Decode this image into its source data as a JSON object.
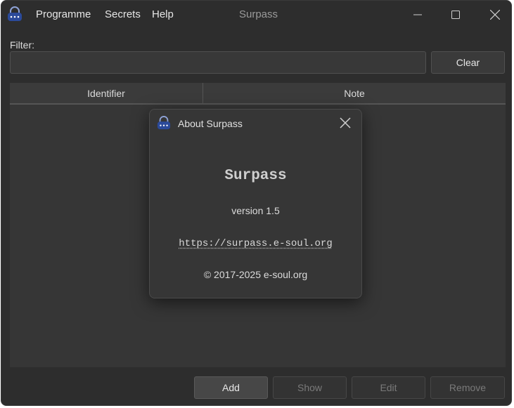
{
  "window": {
    "title": "Surpass"
  },
  "menu": [
    {
      "label": "Programme"
    },
    {
      "label": "Secrets"
    },
    {
      "label": "Help"
    }
  ],
  "filter": {
    "label": "Filter:",
    "value": "",
    "placeholder": ""
  },
  "buttons": {
    "clear": "Clear",
    "add": "Add",
    "show": "Show",
    "edit": "Edit",
    "remove": "Remove"
  },
  "table": {
    "columns": [
      "Identifier",
      "Note"
    ],
    "rows": []
  },
  "about_dialog": {
    "title": "About Surpass",
    "app_name": "Surpass",
    "version": "version 1.5",
    "url": "https://surpass.e-soul.org",
    "copyright": "© 2017-2025 e-soul.org"
  },
  "icons": {
    "app": "padlock-app-icon",
    "minimize": "minimize-icon",
    "maximize": "maximize-icon",
    "close": "close-icon"
  },
  "colors": {
    "background": "#2d2d2d",
    "dialog": "#363636",
    "app_icon": "#2b4a9a"
  }
}
